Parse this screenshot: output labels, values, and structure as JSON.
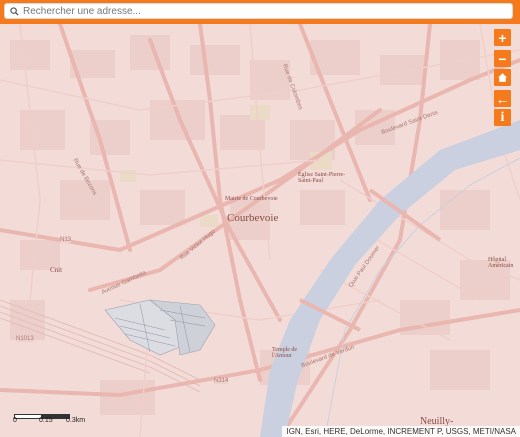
{
  "search": {
    "placeholder": "Rechercher une adresse..."
  },
  "controls": [
    {
      "name": "zoom-in-button",
      "glyph": "+"
    },
    {
      "name": "zoom-out-button",
      "glyph": "−"
    },
    {
      "name": "home-button",
      "glyph": "home-icon"
    },
    {
      "name": "back-button",
      "glyph": "←"
    },
    {
      "name": "info-button",
      "glyph": "i"
    }
  ],
  "map": {
    "labels": {
      "courbevoie": "Courbevoie",
      "mairie": "Mairie de Courbevoie",
      "eglise": "Église Saint-Pierre-Saint-Paul",
      "temple": "Temple de l'Amour",
      "neuilly": "Neuilly-",
      "hopital": "Hôpital Américain",
      "n13": "N13",
      "n1013": "N1013",
      "n314": "N314",
      "cnit": "Cnit"
    },
    "streets": {
      "rue_victor_hugo": "Rue Victor Hugo",
      "bd_saint_denis": "Boulevard Saint-Denis",
      "av_gambetta": "Avenue Gambetta",
      "rue_de_bezons": "Rue de Bezons",
      "bd_verdun": "Boulevard de Verdun",
      "rue_de_colombes": "Rue de Colombes",
      "quai_paul_doumer": "Quai Paul Doumer"
    }
  },
  "scale": {
    "labels": [
      "0",
      "0.15",
      "0.3km"
    ]
  },
  "attribution": "IGN, Esri, HERE, DeLorme, INCREMENT P, USGS, METI/NASA",
  "colors": {
    "accent": "#f57a1c",
    "base": "#f3dcd8",
    "river": "#cad0df",
    "road": "#e8b9b3"
  }
}
